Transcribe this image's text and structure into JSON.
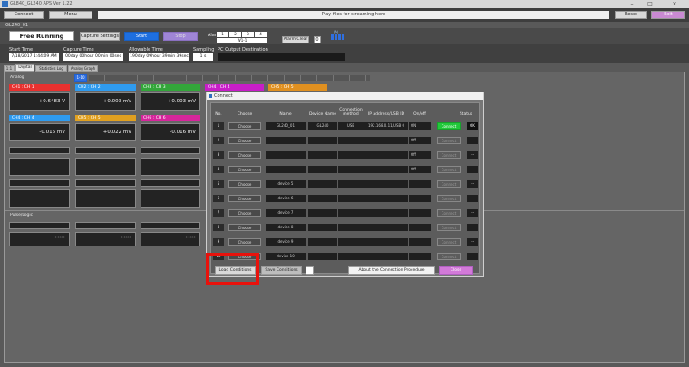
{
  "window": {
    "title": "GL840_GL240 APS Ver 1.22",
    "minimize": "–",
    "maximize": "□",
    "close": "×"
  },
  "toolbar": {
    "connect_label": "Connect",
    "menu_label": "Menu",
    "status_message": "Play files for streaming here",
    "reset_label": "Reset",
    "exit_label": "Exit"
  },
  "device_tab": "GL240_01",
  "mode": {
    "label": "Free Running",
    "capture_settings_label": "Capture Settings",
    "start_label": "Start",
    "stop_label": "Stop"
  },
  "alarm": {
    "label": "Alarm",
    "digits": [
      "1",
      "2",
      "3",
      "4"
    ],
    "level_label": "W1-1",
    "clear_label": "Alarm Clear",
    "count": "0",
    "indicator_label": "(A)"
  },
  "info": {
    "start_time_label": "Start Time",
    "start_time_value": "7/18/2017 1:44:09 AM",
    "capture_time_label": "Capture Time",
    "capture_time_value": "00day 00hour 00min 00sec",
    "allowable_time_label": "Allowable Time",
    "allowable_time_value": "190day 09hour 39min 39sec",
    "sampling_label": "Sampling",
    "sampling_value": "1 s",
    "pc_output_label": "PC Output Destination",
    "pc_output_value": ""
  },
  "tabs": [
    "1:1",
    "Digital",
    "Statistics Log",
    "Analog Graph"
  ],
  "sub_tab": "1-10",
  "analog_label": "Analog",
  "pulse_logic_label": "Pulse/Logic",
  "channels": [
    {
      "name": "CH1 : CH 1",
      "value": "+0.6483 V",
      "color": "#e8312f"
    },
    {
      "name": "CH2 : CH 2",
      "value": "+0.003 mV",
      "color": "#2f9bef"
    },
    {
      "name": "CH3 : CH 3",
      "value": "+0.003 mV",
      "color": "#33a63a"
    },
    {
      "name": "CH4 : CH 4",
      "value": "-0.016 mV",
      "color": "#2f9bef"
    },
    {
      "name": "CH5 : CH 5",
      "value": "+0.022 mV",
      "color": "#e0a020"
    },
    {
      "name": "CH6 : CH 6",
      "value": "-0.016 mV",
      "color": "#d6269b"
    }
  ],
  "partial_channels": [
    {
      "name": "CH4 : CH 4",
      "color": "#c81ec8"
    },
    {
      "name": "CH5 : CH 5",
      "color": "#e09020"
    }
  ],
  "pulse_values": [
    "*****",
    "*****",
    "*****"
  ],
  "dialog": {
    "title": "Connect",
    "headers": {
      "no": "No.",
      "choose": "Choose",
      "name": "Name",
      "device_name": "Device Name",
      "connection_method": "Connection method",
      "ip": "IP address/USB ID",
      "on_off": "On/off",
      "status": "Status"
    },
    "rows": [
      {
        "no": "1",
        "choose": "Choose",
        "name": "GL240_01",
        "device": "GL240",
        "method": "USB",
        "ip": "192.168.0.11/USB 0",
        "onoff": "ON",
        "connect": "Connect",
        "status": "OK"
      },
      {
        "no": "2",
        "choose": "Choose",
        "name": "",
        "device": "",
        "method": "",
        "ip": "",
        "onoff": "Off",
        "connect": "Connect",
        "status": "---"
      },
      {
        "no": "3",
        "choose": "Choose",
        "name": "",
        "device": "",
        "method": "",
        "ip": "",
        "onoff": "Off",
        "connect": "Connect",
        "status": "---"
      },
      {
        "no": "4",
        "choose": "Choose",
        "name": "",
        "device": "",
        "method": "",
        "ip": "",
        "onoff": "Off",
        "connect": "Connect",
        "status": "---"
      },
      {
        "no": "5",
        "choose": "Choose",
        "name": "device 5",
        "device": "",
        "method": "",
        "ip": "",
        "onoff": "",
        "connect": "Connect",
        "status": "---"
      },
      {
        "no": "6",
        "choose": "Choose",
        "name": "device 6",
        "device": "",
        "method": "",
        "ip": "",
        "onoff": "",
        "connect": "Connect",
        "status": "---"
      },
      {
        "no": "7",
        "choose": "Choose",
        "name": "device 7",
        "device": "",
        "method": "",
        "ip": "",
        "onoff": "",
        "connect": "Connect",
        "status": "---"
      },
      {
        "no": "8",
        "choose": "Choose",
        "name": "device 8",
        "device": "",
        "method": "",
        "ip": "",
        "onoff": "",
        "connect": "Connect",
        "status": "---"
      },
      {
        "no": "9",
        "choose": "Choose",
        "name": "device 9",
        "device": "",
        "method": "",
        "ip": "",
        "onoff": "",
        "connect": "Connect",
        "status": "---"
      },
      {
        "no": "10",
        "choose": "Choose",
        "name": "device 10",
        "device": "",
        "method": "",
        "ip": "",
        "onoff": "",
        "connect": "Connect",
        "status": "---"
      }
    ],
    "load_label": "Load Conditions",
    "save_label": "Save Conditions",
    "about_label": "About the Connection Procedure",
    "close_label": "Close"
  },
  "colors": {
    "highlight": "#e8120c",
    "start_btn": "#1e6fe0",
    "stop_btn": "#9f85d6",
    "connected": "#21c93a",
    "close_btn": "#d27ad8"
  }
}
